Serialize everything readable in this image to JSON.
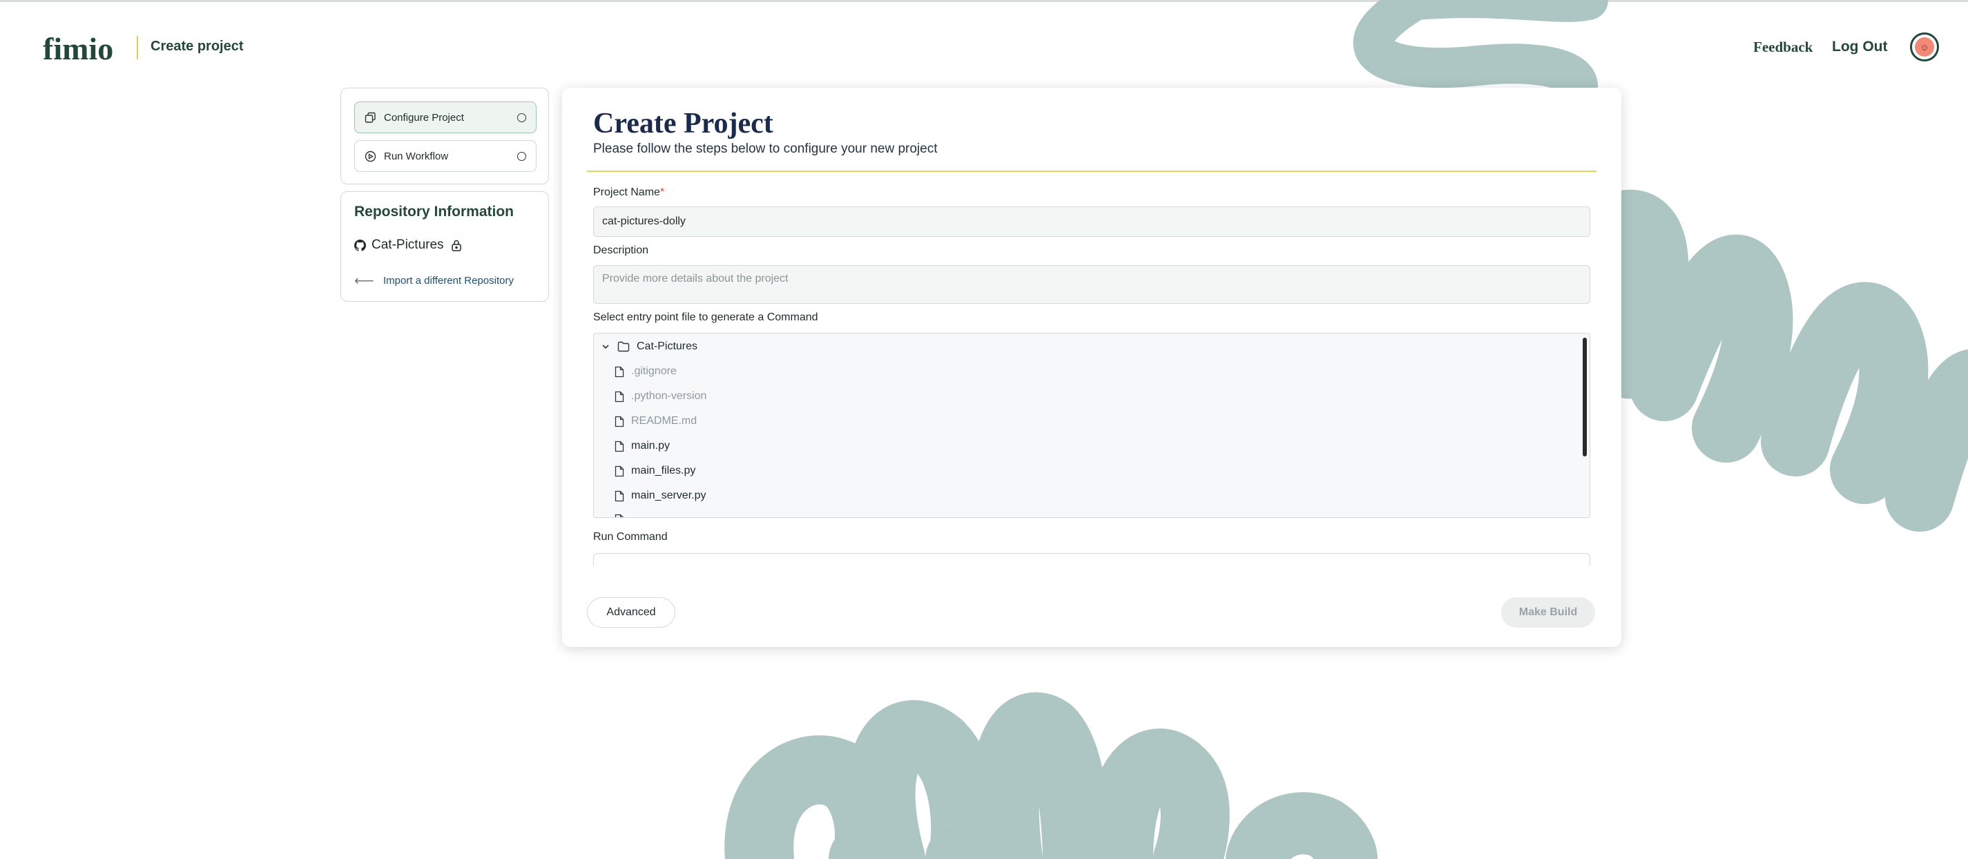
{
  "header": {
    "crumb": "Create project",
    "feedback": "Feedback",
    "logout": "Log Out"
  },
  "sidebar": {
    "steps": [
      {
        "label": "Configure Project",
        "active": true
      },
      {
        "label": "Run Workflow",
        "active": false
      }
    ],
    "repo": {
      "title": "Repository Information",
      "name": "Cat-Pictures",
      "import_label": "Import a different Repository"
    }
  },
  "form": {
    "title": "Create Project",
    "subtitle": "Please follow the steps below to configure your new project",
    "project_name_label": "Project Name",
    "required_mark": "*",
    "project_name_value": "cat-pictures-dolly",
    "description_label": "Description",
    "description_placeholder": "Provide more details about the project",
    "entry_label": "Select entry point file to generate a Command",
    "run_command_label": "Run Command"
  },
  "file_tree": {
    "folder": "Cat-Pictures",
    "files": [
      {
        "name": ".gitignore",
        "dimmed": true
      },
      {
        "name": ".python-version",
        "dimmed": true
      },
      {
        "name": "README.md",
        "dimmed": true
      },
      {
        "name": "main.py",
        "dimmed": false
      },
      {
        "name": "main_files.py",
        "dimmed": false
      },
      {
        "name": "main_server.py",
        "dimmed": false
      }
    ]
  },
  "buttons": {
    "advanced": "Advanced",
    "make_build": "Make Build"
  },
  "colors": {
    "brand_green": "#24473c",
    "deco_sage": "#adc6c3",
    "accent_yellow": "#e6d45a"
  }
}
